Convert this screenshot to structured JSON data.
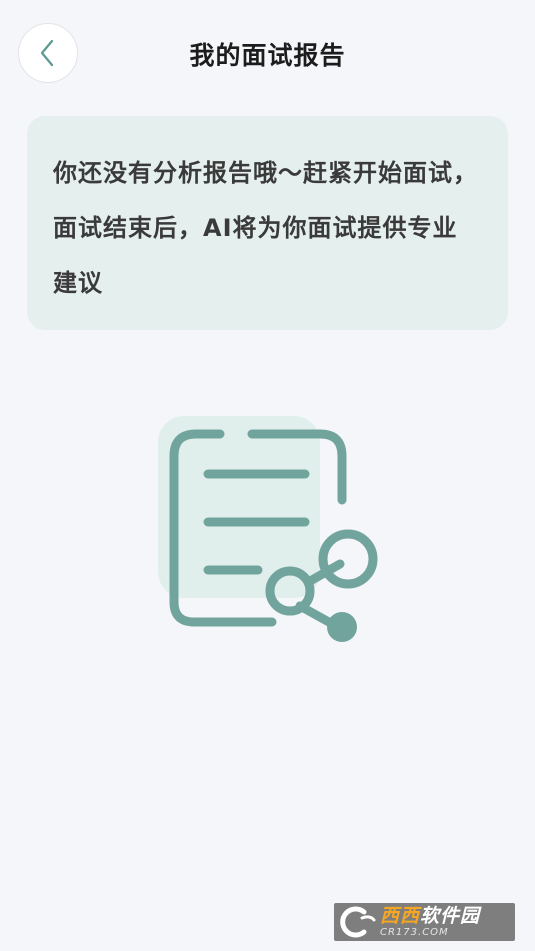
{
  "header": {
    "title": "我的面试报告",
    "back_icon": "chevron-left-icon"
  },
  "notice": {
    "text": "你还没有分析报告哦～赶紧开始面试，面试结束后，AI将为你面试提供专业建议"
  },
  "illustration": {
    "icon": "report-share-icon",
    "colors": {
      "stroke": "#72a49e",
      "background": "#e1efec"
    }
  },
  "watermark": {
    "brand_orange": "西西",
    "brand_white": "软件园",
    "url": "CR173.COM"
  },
  "colors": {
    "background": "#f5f6f9",
    "card": "#e5efee",
    "accent": "#72a49e",
    "title": "#1c1c1c"
  }
}
